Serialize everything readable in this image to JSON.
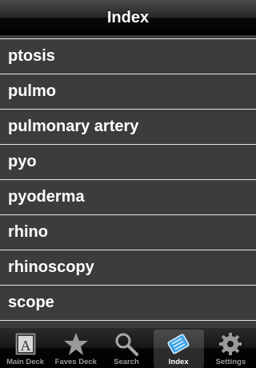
{
  "nav": {
    "title": "Index"
  },
  "list": {
    "items": [
      {
        "label": "ptosis"
      },
      {
        "label": "pulmo"
      },
      {
        "label": "pulmonary artery"
      },
      {
        "label": "pyo"
      },
      {
        "label": "pyoderma"
      },
      {
        "label": "rhino"
      },
      {
        "label": "rhinoscopy"
      },
      {
        "label": "scope"
      }
    ]
  },
  "tabbar": {
    "tabs": [
      {
        "label": "Main Deck",
        "icon": "book-letter-a-icon"
      },
      {
        "label": "Faves Deck",
        "icon": "star-icon"
      },
      {
        "label": "Search",
        "icon": "magnifier-icon"
      },
      {
        "label": "Index",
        "icon": "index-notebook-icon",
        "active": true
      },
      {
        "label": "Settings",
        "icon": "gear-icon"
      }
    ]
  }
}
